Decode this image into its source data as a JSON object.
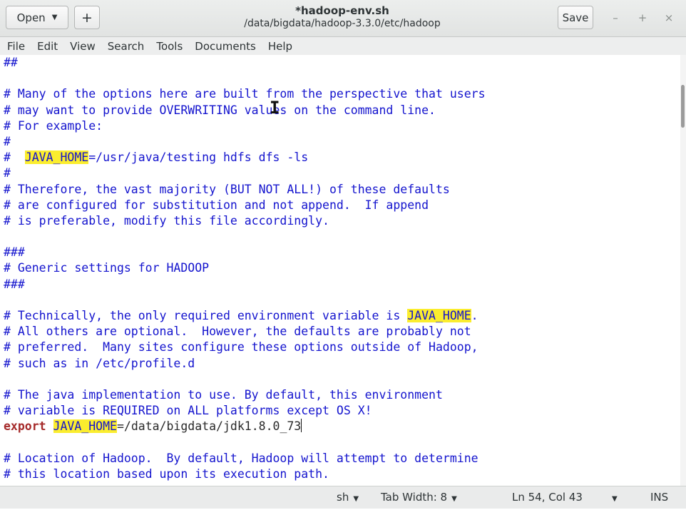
{
  "header": {
    "open_label": "Open",
    "new_tab_label": "+",
    "title": "*hadoop-env.sh",
    "subtitle": "/data/bigdata/hadoop-3.3.0/etc/hadoop",
    "save_label": "Save",
    "minimize": "–",
    "maximize": "+",
    "close": "×"
  },
  "menu": [
    "File",
    "Edit",
    "View",
    "Search",
    "Tools",
    "Documents",
    "Help"
  ],
  "editor": {
    "lines": [
      [
        {
          "t": "##",
          "c": "comment"
        }
      ],
      [],
      [
        {
          "t": "# Many of the options here are built from the perspective that users",
          "c": "comment"
        }
      ],
      [
        {
          "t": "# may want to provide OVERWRITING values on the command line.",
          "c": "comment"
        }
      ],
      [
        {
          "t": "# For example:",
          "c": "comment"
        }
      ],
      [
        {
          "t": "#",
          "c": "comment"
        }
      ],
      [
        {
          "t": "#  ",
          "c": "comment"
        },
        {
          "t": "JAVA_HOME",
          "c": "hl"
        },
        {
          "t": "=/usr/java/testing hdfs dfs -ls",
          "c": "comment"
        }
      ],
      [
        {
          "t": "#",
          "c": "comment"
        }
      ],
      [
        {
          "t": "# Therefore, the vast majority (BUT NOT ALL!) of these defaults",
          "c": "comment"
        }
      ],
      [
        {
          "t": "# are configured for substitution and not append.  If append",
          "c": "comment"
        }
      ],
      [
        {
          "t": "# is preferable, modify this file accordingly.",
          "c": "comment"
        }
      ],
      [],
      [
        {
          "t": "###",
          "c": "comment"
        }
      ],
      [
        {
          "t": "# Generic settings for HADOOP",
          "c": "comment"
        }
      ],
      [
        {
          "t": "###",
          "c": "comment"
        }
      ],
      [],
      [
        {
          "t": "# Technically, the only required environment variable is ",
          "c": "comment"
        },
        {
          "t": "JAVA_HOME",
          "c": "hl"
        },
        {
          "t": ".",
          "c": "comment"
        }
      ],
      [
        {
          "t": "# All others are optional.  However, the defaults are probably not",
          "c": "comment"
        }
      ],
      [
        {
          "t": "# preferred.  Many sites configure these options outside of Hadoop,",
          "c": "comment"
        }
      ],
      [
        {
          "t": "# such as in /etc/profile.d",
          "c": "comment"
        }
      ],
      [],
      [
        {
          "t": "# The java implementation to use. By default, this environment",
          "c": "comment"
        }
      ],
      [
        {
          "t": "# variable is REQUIRED on ALL platforms except OS X!",
          "c": "comment"
        }
      ],
      [
        {
          "t": "export",
          "c": "kw"
        },
        {
          "t": " ",
          "c": "plain"
        },
        {
          "t": "JAVA_HOME",
          "c": "hl"
        },
        {
          "t": "=/data/bigdata/",
          "c": "plain"
        },
        {
          "t": "jdk1.8.0_73",
          "c": "plain"
        },
        {
          "t": "",
          "c": "caret"
        }
      ],
      [],
      [
        {
          "t": "# Location of Hadoop.  By default, Hadoop will attempt to determine",
          "c": "comment"
        }
      ],
      [
        {
          "t": "# this location based upon its execution path.",
          "c": "comment"
        }
      ]
    ]
  },
  "status": {
    "language": "sh",
    "tab_width": "Tab Width: 8",
    "position": "Ln 54, Col 43",
    "mode": "INS"
  },
  "colors": {
    "comment": "#1414ce",
    "keyword": "#a52a2a",
    "highlight": "#fbed2e"
  }
}
